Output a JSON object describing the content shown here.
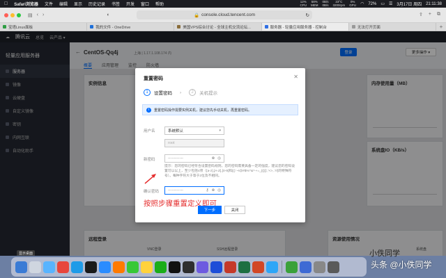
{
  "menubar": {
    "app": "Safari浏览器",
    "items": [
      "文件",
      "编辑",
      "显示",
      "历史记录",
      "书签",
      "开发",
      "窗口",
      "帮助"
    ],
    "stats": [
      {
        "top": "12%",
        "bottom": "CPU"
      },
      {
        "top": "58%",
        "bottom": "MEM"
      },
      {
        "top": "0B/s",
        "bottom": "0B/s"
      },
      {
        "top": "23°C",
        "bottom": "3200rpm"
      },
      {
        "top": "0%",
        "bottom": "GPU"
      }
    ],
    "battery": "72%",
    "date": "3月17日 周四",
    "time": "21:11:38"
  },
  "toolbar": {
    "url": "console.cloud.tencent.com"
  },
  "tabs": [
    {
      "label": "宝塔Linux面板",
      "color": "#2f9e44"
    },
    {
      "label": "我的文件 - OneDrive",
      "color": "#1e6fd9"
    },
    {
      "label": "美国VPS综合讨论 - 全球主机交流论坛...",
      "color": "#8a6d3b"
    },
    {
      "label": "服务器 - 轻量应用服务器 - 控制台",
      "color": "#2f6fe4"
    },
    {
      "label": "无法打开页面",
      "color": "#999999"
    }
  ],
  "console": {
    "logo": "腾讯云",
    "nav_home": "总览",
    "nav_products": "云产品 ▾",
    "section": "轻量应用服务器",
    "side_items": [
      "服务器",
      "镜像",
      "云硬盘",
      "自定义镜像",
      "密钥",
      "内网互联",
      "自动化助手"
    ],
    "instance_name": "CentOS-Qq4j",
    "instance_sub": "上海 | 1.17.1.108.174 内",
    "content_tabs": [
      "概要",
      "应用管理",
      "监控",
      "防火墙"
    ],
    "card_instance": "实例信息",
    "card_memory": "内存使用量（MB）",
    "card_disk": "系统盘IO（KB/s）",
    "card_remote": "远程登录",
    "card_resource": "资源使用情况",
    "vnc": "VNC登录",
    "ssh": "SSH远程登录",
    "sys_disk": "系统盘",
    "btn_login": "登录",
    "btn_more": "更多操作 ▾"
  },
  "modal": {
    "title": "重置密码",
    "close": "✕",
    "step1_num": "1",
    "step1_label": "设置密码",
    "step2_num": "2",
    "step2_label": "关机提示",
    "notice": "重置密码操作需要实例关机，建议您先手动关机，再重置密码。",
    "username_label": "用户名",
    "username_value": "系统默认",
    "root_value": "root",
    "newpwd_label": "新密码",
    "newpwd_value": "············",
    "hint": "提示：您的密码已经符合设置密码规则，您的密码需要具备一定的强度，建议您的密码设置可以以上，至少包括4项（[a-z],[A-Z],[0-9]和[()`~!@#$%^&*-+=_|{}[]:;'<>,.?/]的特殊符号）。每种字符大于等于2位及不相同。",
    "confirm_label": "确认密码",
    "confirm_value": "············",
    "next_button": "下一步",
    "close_button": "关闭"
  },
  "annotation": {
    "text": "按照步骤重置定义即可",
    "color": "#e53030"
  },
  "tooltip": "显示桌面",
  "watermark": {
    "small": "小佚同学",
    "big": "头条 @小佚同学"
  },
  "dock": {
    "colors": [
      "#3a7bd5",
      "#cfd6e0",
      "#58b4ff",
      "#e8463d",
      "#1f9be8",
      "#1a1a1a",
      "#2a8cff",
      "#ff7a00",
      "#37c837",
      "#ffd23c",
      "#1aad19",
      "#111111",
      "#2e2e2e",
      "#6d5be0",
      "#1d4ed8",
      "#c53929",
      "#1d6f42",
      "#d24726",
      "#2ea6f7",
      "#3aa13a",
      "#3e6ad4",
      "#888888",
      "#5a5a5a"
    ]
  }
}
